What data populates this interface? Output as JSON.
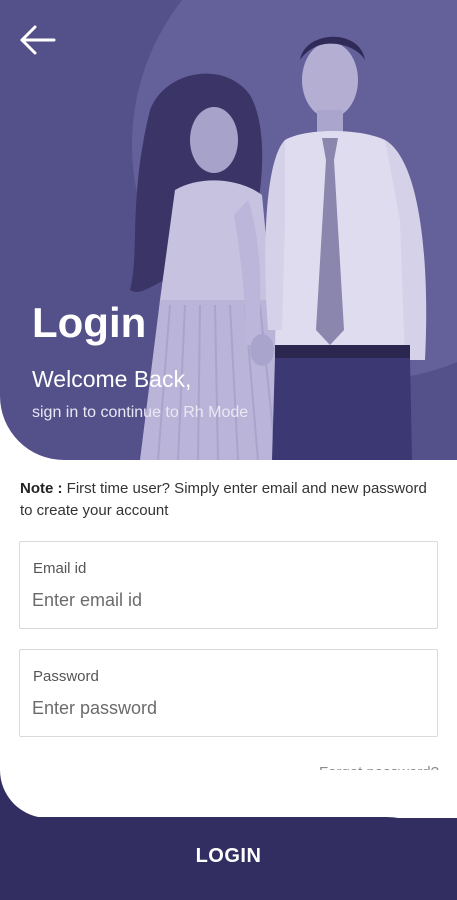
{
  "header": {
    "back_icon": "arrow-left-icon",
    "title": "Login",
    "welcome": "Welcome Back,",
    "subtitle": "sign in to continue to Rh Mode"
  },
  "note": {
    "label": "Note :",
    "text": " First time user? Simply enter email and new password to create your account"
  },
  "form": {
    "email": {
      "label": "Email id",
      "placeholder": "Enter email id",
      "value": ""
    },
    "password": {
      "label": "Password",
      "placeholder": "Enter password",
      "value": ""
    },
    "forgot_label": "Forgot password?",
    "submit_label": "LOGIN"
  },
  "colors": {
    "hero_bg": "#54508a",
    "hero_circle": "#64609a",
    "primary": "#322e62",
    "muted_text": "#8a8a8a",
    "border": "#d9d9de"
  }
}
